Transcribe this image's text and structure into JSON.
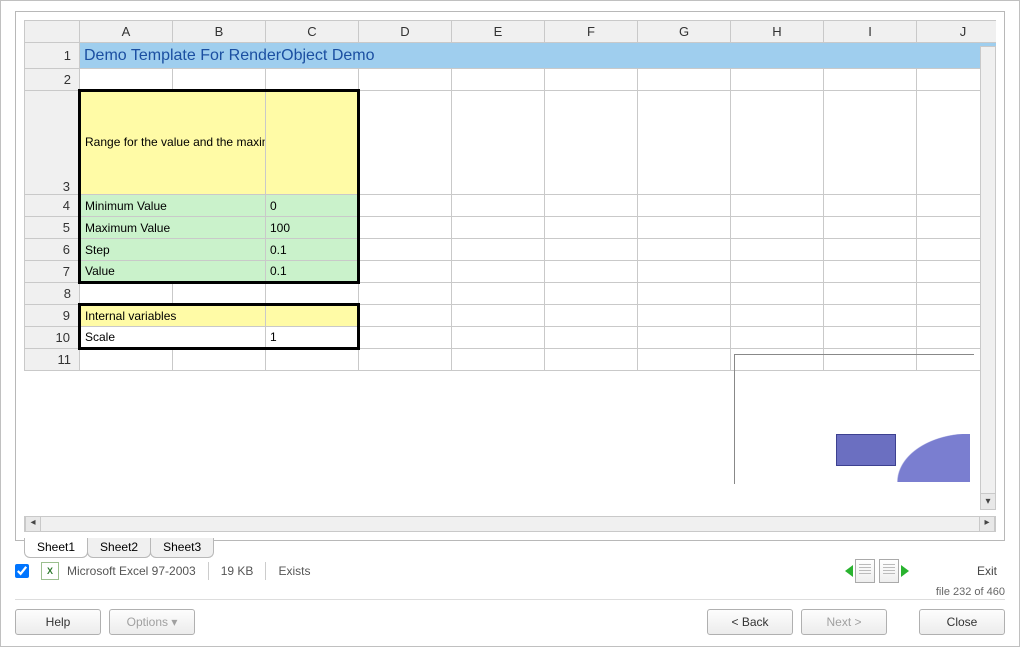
{
  "columns": [
    "A",
    "B",
    "C",
    "D",
    "E",
    "F",
    "G",
    "H",
    "I",
    "J"
  ],
  "rows": [
    "1",
    "2",
    "3",
    "4",
    "5",
    "6",
    "7",
    "8",
    "9",
    "10",
    "11"
  ],
  "title_row": "Demo Template For RenderObject Demo",
  "block1": {
    "desc": "Range for the value and the maximum and minimum it can be. Those ranges will be read by the app so it knows how to work.",
    "rows": [
      {
        "label": "Minimum Value",
        "value": "0"
      },
      {
        "label": "Maximum Value",
        "value": "100"
      },
      {
        "label": "Step",
        "value": "0.1"
      },
      {
        "label": "Value",
        "value": "0.1"
      }
    ]
  },
  "block2": {
    "header": "Internal variables",
    "rows": [
      {
        "label": "Scale",
        "value": "1"
      }
    ]
  },
  "tabs": [
    "Sheet1",
    "Sheet2",
    "Sheet3"
  ],
  "status": {
    "filetype": "Microsoft Excel 97-2003",
    "size": "19 KB",
    "state": "Exists",
    "exit": "Exit"
  },
  "fileline": "file 232 of 460",
  "buttons": {
    "help": "Help",
    "options": "Options ▾",
    "back": "< Back",
    "next": "Next >",
    "close": "Close"
  }
}
